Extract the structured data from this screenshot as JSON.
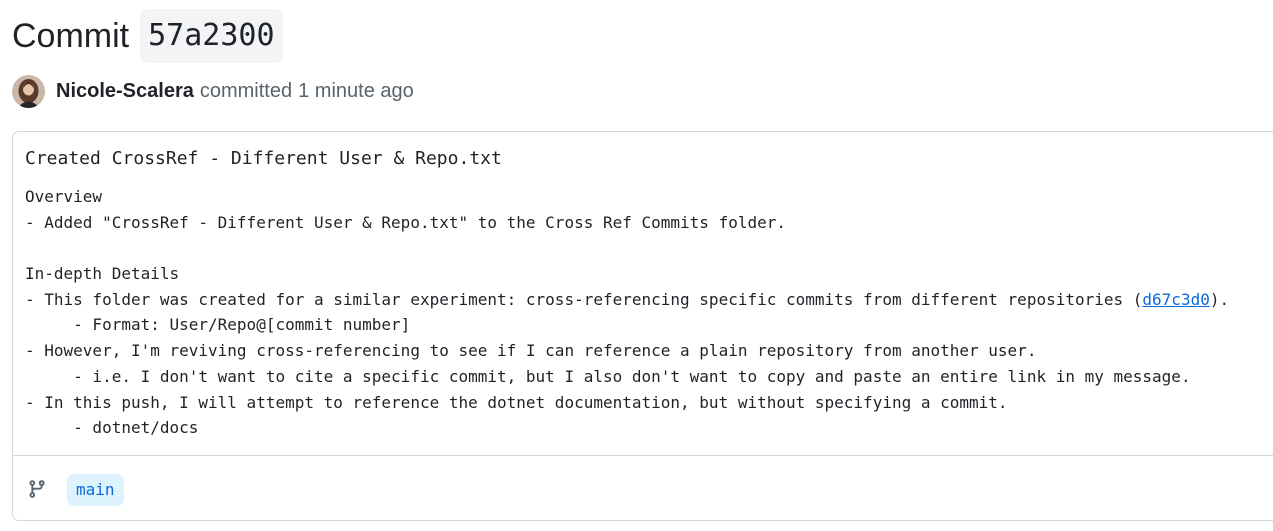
{
  "header": {
    "title_prefix": "Commit",
    "sha": "57a2300"
  },
  "author": {
    "name": "Nicole-Scalera",
    "action": "committed",
    "time": "1 minute ago",
    "avatar_icon": "user-avatar"
  },
  "commit": {
    "title": "Created CrossRef - Different User & Repo.txt",
    "lines": {
      "l1": "Overview",
      "l2": "- Added \"CrossRef - Different User & Repo.txt\" to the Cross Ref Commits folder.",
      "l3": "",
      "l4": "In-depth Details",
      "l5_pre": "- This folder was created for a similar experiment: cross-referencing specific commits from different repositories (",
      "l5_link": "d67c3d0",
      "l5_post": ").",
      "l6": "     - Format: User/Repo@[commit number]",
      "l7": "- However, I'm reviving cross-referencing to see if I can reference a plain repository from another user.",
      "l8": "     - i.e. I don't want to cite a specific commit, but I also don't want to copy and paste an entire link in my message.",
      "l9": "- In this push, I will attempt to reference the dotnet documentation, but without specifying a commit.",
      "l10": "     - dotnet/docs"
    }
  },
  "footer": {
    "branch_icon": "git-branch-icon",
    "branch": "main"
  },
  "colors": {
    "link": "#0969da",
    "muted": "#59636e",
    "border": "#d1d9e0",
    "branch_bg": "#ddf4ff",
    "sha_bg": "#f3f4f6"
  }
}
